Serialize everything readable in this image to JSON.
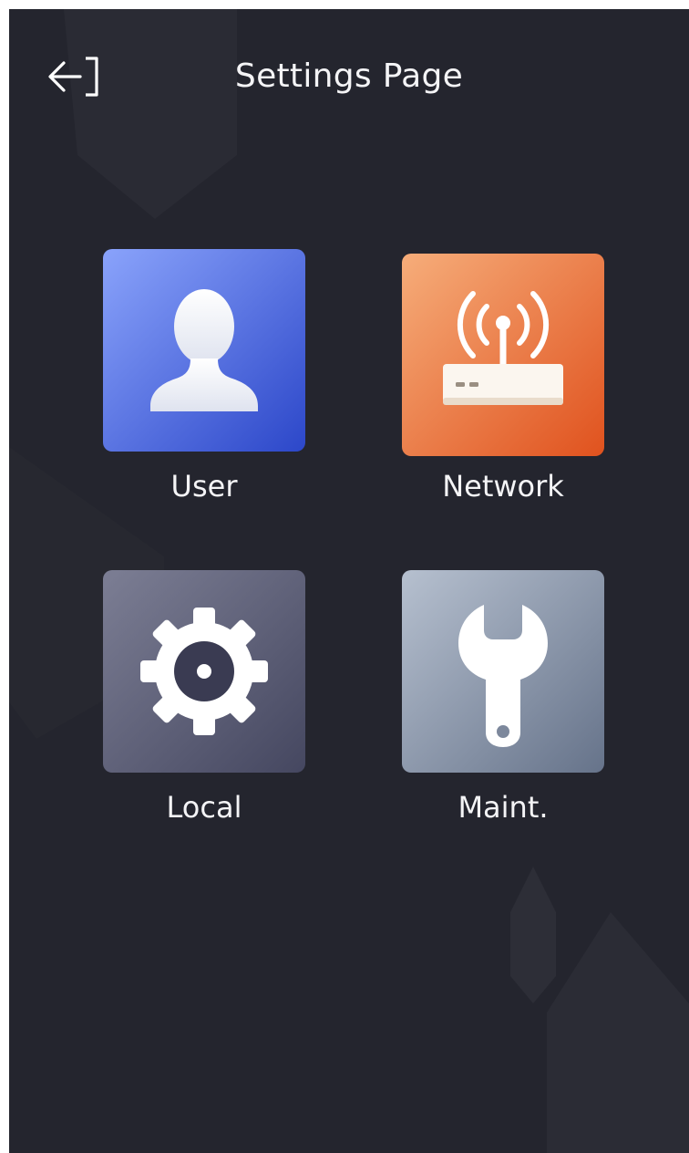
{
  "header": {
    "title": "Settings Page",
    "back_icon": "exit-arrow-icon"
  },
  "tiles": [
    {
      "label": "User",
      "icon": "user-silhouette-icon",
      "colors": [
        "#8aa3fb",
        "#2c47c9"
      ]
    },
    {
      "label": "Network",
      "icon": "router-antenna-icon",
      "colors": [
        "#f6ad7a",
        "#e0521e"
      ]
    },
    {
      "label": "Local",
      "icon": "gear-icon",
      "colors": [
        "#7c7e94",
        "#454760"
      ]
    },
    {
      "label": "Maint.",
      "icon": "wrench-icon",
      "colors": [
        "#b6c0cf",
        "#66738a"
      ]
    }
  ],
  "theme": {
    "background": "#24252e",
    "text": "#f4f4f6"
  }
}
